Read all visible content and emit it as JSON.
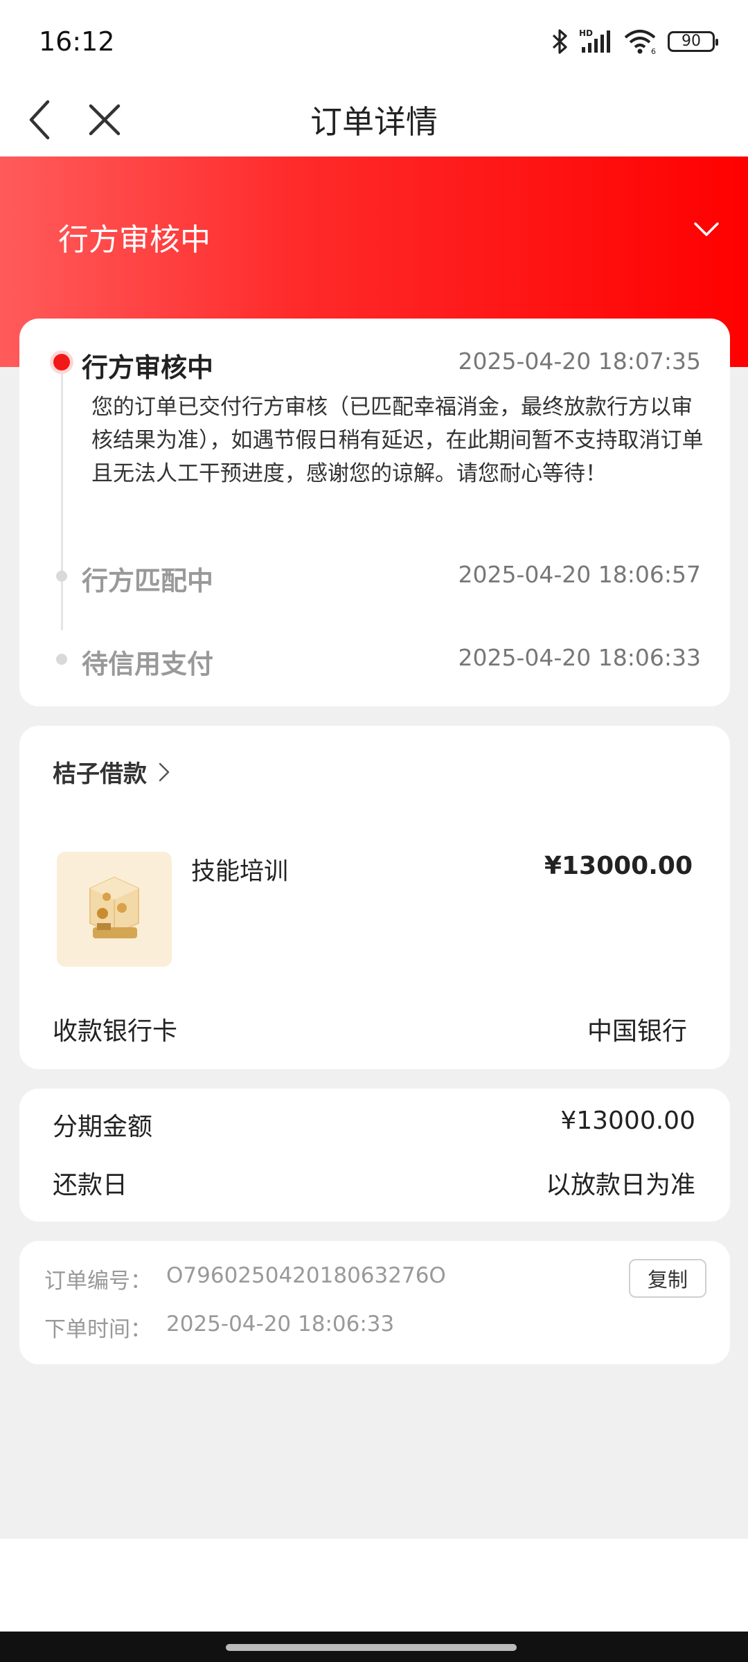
{
  "status_bar": {
    "time": "16:12",
    "icons": [
      "bluetooth-icon",
      "hd-signal-icon",
      "wifi-icon",
      "battery-icon"
    ],
    "battery": "90"
  },
  "nav": {
    "title": "订单详情",
    "back_icon": "chevron-left-icon",
    "close_icon": "close-icon"
  },
  "header": {
    "status": "行方审核中",
    "toggle_icon": "chevron-down-icon",
    "accent": "#ff1a1a"
  },
  "timeline": [
    {
      "title": "行方审核中",
      "time": "2025-04-20 18:07:35",
      "desc": "您的订单已交付行方审核（已匹配幸福消金，最终放款行方以审核结果为准），如遇节假日稍有延迟，在此期间暂不支持取消订单且无法人工干预进度，感谢您的谅解。请您耐心等待！"
    },
    {
      "title": "行方匹配中",
      "time": "2025-04-20 18:06:57"
    },
    {
      "title": "待信用支付",
      "time": "2025-04-20 18:06:33"
    }
  ],
  "product": {
    "merchant": "桔子借款",
    "name": "技能培训",
    "price": "¥13000.00",
    "bank_label": "收款银行卡",
    "bank_value": "中国银行"
  },
  "installment": {
    "amount_label": "分期金额",
    "amount_value": "¥13000.00",
    "repay_label": "还款日",
    "repay_value": "以放款日为准"
  },
  "order": {
    "number_label": "订单编号：",
    "number_value": "O796025042018063276O",
    "time_label": "下单时间：",
    "time_value": "2025-04-20 18:06:33",
    "copy_label": "复制"
  }
}
